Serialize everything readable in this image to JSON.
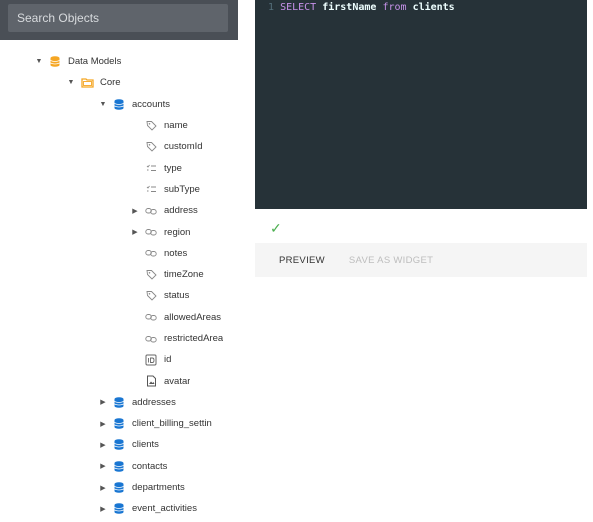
{
  "search": {
    "placeholder": "Search Objects",
    "value": ""
  },
  "tree": [
    {
      "label": "Data Models",
      "caret": "▼",
      "icon": "database-orange-icon",
      "depth": 0
    },
    {
      "label": "Core",
      "caret": "▼",
      "icon": "folder-icon",
      "depth": 1
    },
    {
      "label": "accounts",
      "caret": "▼",
      "icon": "table-blue-icon",
      "depth": 2
    },
    {
      "label": "name",
      "caret": "",
      "icon": "tag-icon",
      "depth": 3
    },
    {
      "label": "customId",
      "caret": "",
      "icon": "tag-icon",
      "depth": 3
    },
    {
      "label": "type",
      "caret": "",
      "icon": "list-icon",
      "depth": 3
    },
    {
      "label": "subType",
      "caret": "",
      "icon": "list-icon",
      "depth": 3
    },
    {
      "label": "address",
      "caret": "▶",
      "icon": "link-icon",
      "depth": 3
    },
    {
      "label": "region",
      "caret": "▶",
      "icon": "link-icon",
      "depth": 3
    },
    {
      "label": "notes",
      "caret": "",
      "icon": "link-icon",
      "depth": 3
    },
    {
      "label": "timeZone",
      "caret": "",
      "icon": "tag-icon",
      "depth": 3
    },
    {
      "label": "status",
      "caret": "",
      "icon": "tag-icon",
      "depth": 3
    },
    {
      "label": "allowedAreas",
      "caret": "",
      "icon": "link-icon",
      "depth": 3
    },
    {
      "label": "restrictedArea",
      "caret": "",
      "icon": "link-icon",
      "depth": 3
    },
    {
      "label": "id",
      "caret": "",
      "icon": "id-icon",
      "depth": 3
    },
    {
      "label": "avatar",
      "caret": "",
      "icon": "image-icon",
      "depth": 3
    },
    {
      "label": "addresses",
      "caret": "▶",
      "icon": "table-blue-icon",
      "depth": 2
    },
    {
      "label": "client_billing_settin",
      "caret": "▶",
      "icon": "table-blue-icon",
      "depth": 2
    },
    {
      "label": "clients",
      "caret": "▶",
      "icon": "table-blue-icon",
      "depth": 2
    },
    {
      "label": "contacts",
      "caret": "▶",
      "icon": "table-blue-icon",
      "depth": 2
    },
    {
      "label": "departments",
      "caret": "▶",
      "icon": "table-blue-icon",
      "depth": 2
    },
    {
      "label": "event_activities",
      "caret": "▶",
      "icon": "table-blue-icon",
      "depth": 2
    }
  ],
  "editor": {
    "line_number": "1",
    "tokens": {
      "select": "SELECT",
      "field": "firstName",
      "from": "from",
      "table": "clients"
    }
  },
  "status_icon": "checkmark-icon",
  "tabs": {
    "preview": "PREVIEW",
    "save_widget": "SAVE AS WIDGET"
  },
  "colors": {
    "editor_bg": "#263238",
    "keyword": "#c792ea",
    "success": "#4caf50",
    "db_orange": "#f5a623",
    "db_blue": "#1976d2"
  }
}
